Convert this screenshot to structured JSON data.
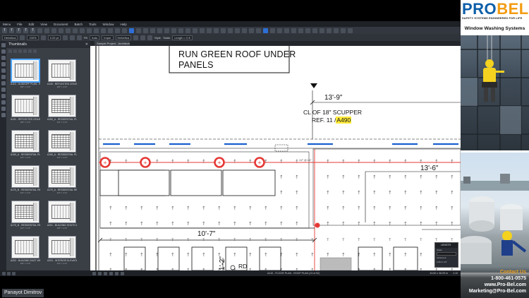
{
  "menu": [
    "Menu",
    "File",
    "Edit",
    "View",
    "Document",
    "Batch",
    "Tools",
    "Window",
    "Help"
  ],
  "toolbar": {
    "font_name": "Helvetica",
    "zoom": "100%",
    "line_width": "0.25 pt",
    "fill_label": "Fill",
    "opacity_label": "100%",
    "fill_value": "Helvetica",
    "style_label": "Style",
    "totals_label": "Totals",
    "length_value": "Length = 0 ft",
    "mode_value": "Auto",
    "units_value": "Imper"
  },
  "thumbnails": {
    "panel_title": "Thumbnails",
    "items": [
      {
        "name": "A110 - SLIDEOFF PLAN - ROOF",
        "scale": "1/8\" = 1'-0\""
      },
      {
        "name": "A130 - REFLECTED CEILING...",
        "scale": "1/8\" = 1'-0\""
      },
      {
        "name": "A131 - REFLECTED CEILING...",
        "scale": "1/8\" = 1'-0\""
      },
      {
        "name": "A150_A - RESIDENTIAL PLA...",
        "scale": "1/4\" = 1'-0\""
      },
      {
        "name": "A150_A - RESIDENTIAL PLA...",
        "scale": "1/4\" = 1'-0\""
      },
      {
        "name": "A150_A - RESIDENTIAL PLA...",
        "scale": "1/4\" = 1'-0\""
      },
      {
        "name": "A170_B - RESIDENTIAL REF...",
        "scale": "1/4\" = 1'-0\""
      },
      {
        "name": "A170_A - RESIDENTIAL REF...",
        "scale": "1/4\" = 1'-0\""
      },
      {
        "name": "A170_B - RESIDENTIAL REF...",
        "scale": "1/4\" = 1'-0\""
      },
      {
        "name": "A201 - BUILDING SOUTH &...",
        "scale": "1/8\" = 1'-0\""
      },
      {
        "name": "A202 - BUILDING EAST WE...",
        "scale": "1/8\" = 1'-0\""
      },
      {
        "name": "A203 - INTERIOR ELEVATIO...",
        "scale": "1/4\" = 1'-0\""
      }
    ]
  },
  "document": {
    "tab_label": "Sample Project - Architectural",
    "note": "RUN GREEN ROOF UNDER\nPANELS",
    "dim_top": "13'-9\"",
    "scupper_line1": "CL OF 18\"  SCUPPER",
    "scupper_line2": "REF. 11 /",
    "scupper_ref": "A490",
    "dim_right": "13'-6\"",
    "dim_center": "10'-7\"",
    "dim_vertical": "1'-2\"",
    "rd_label": "RD",
    "small_label": "1/2\" @ 1/4\"",
    "red_markers": 5
  },
  "status_bar": {
    "page_info": "A110 - FLOOR PLAN - ROOF PLAN (13 of 52)",
    "coords": "43.82 x 36.00 in",
    "zoom": "1:10"
  },
  "length_panel": {
    "title": "LENGTH",
    "row1": "Scale",
    "row2": "Increment",
    "row3": "1/16 in 1/4'"
  },
  "user": {
    "name": "Panayot Dimitrov"
  },
  "ad": {
    "brand_pro": "PRO",
    "brand_bel": "BEL",
    "tagline": "SAFETY SYSTEMS ENGINEERED FOR LIFE",
    "headline": "Window Washing Systems",
    "contact_us": "Contact Us",
    "phone": "1-800-461-0575",
    "website": "www.Pro-Bel.com",
    "email": "Marketing@Pro-Bel.com"
  }
}
